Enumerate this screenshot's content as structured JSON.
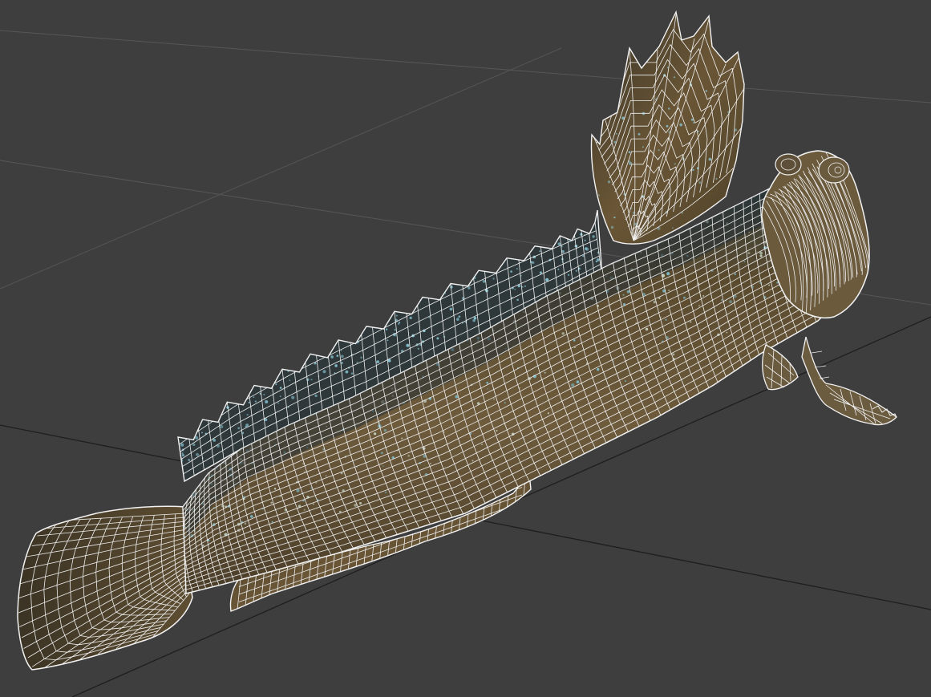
{
  "viewport": {
    "background_color": "#3e3e3e",
    "grid_line_color": "#5a5a5a",
    "grid_axis_color": "#1c1c1c",
    "wireframe_color": "#f2f2f2",
    "skin_color_dark": "#3a3222",
    "skin_color_mid": "#5a4a30",
    "skin_color_light": "#7a6645",
    "spot_color": "#7ec4d6"
  },
  "model": {
    "icon": "fish-wireframe-model",
    "render_mode": "textured-wireframe"
  }
}
